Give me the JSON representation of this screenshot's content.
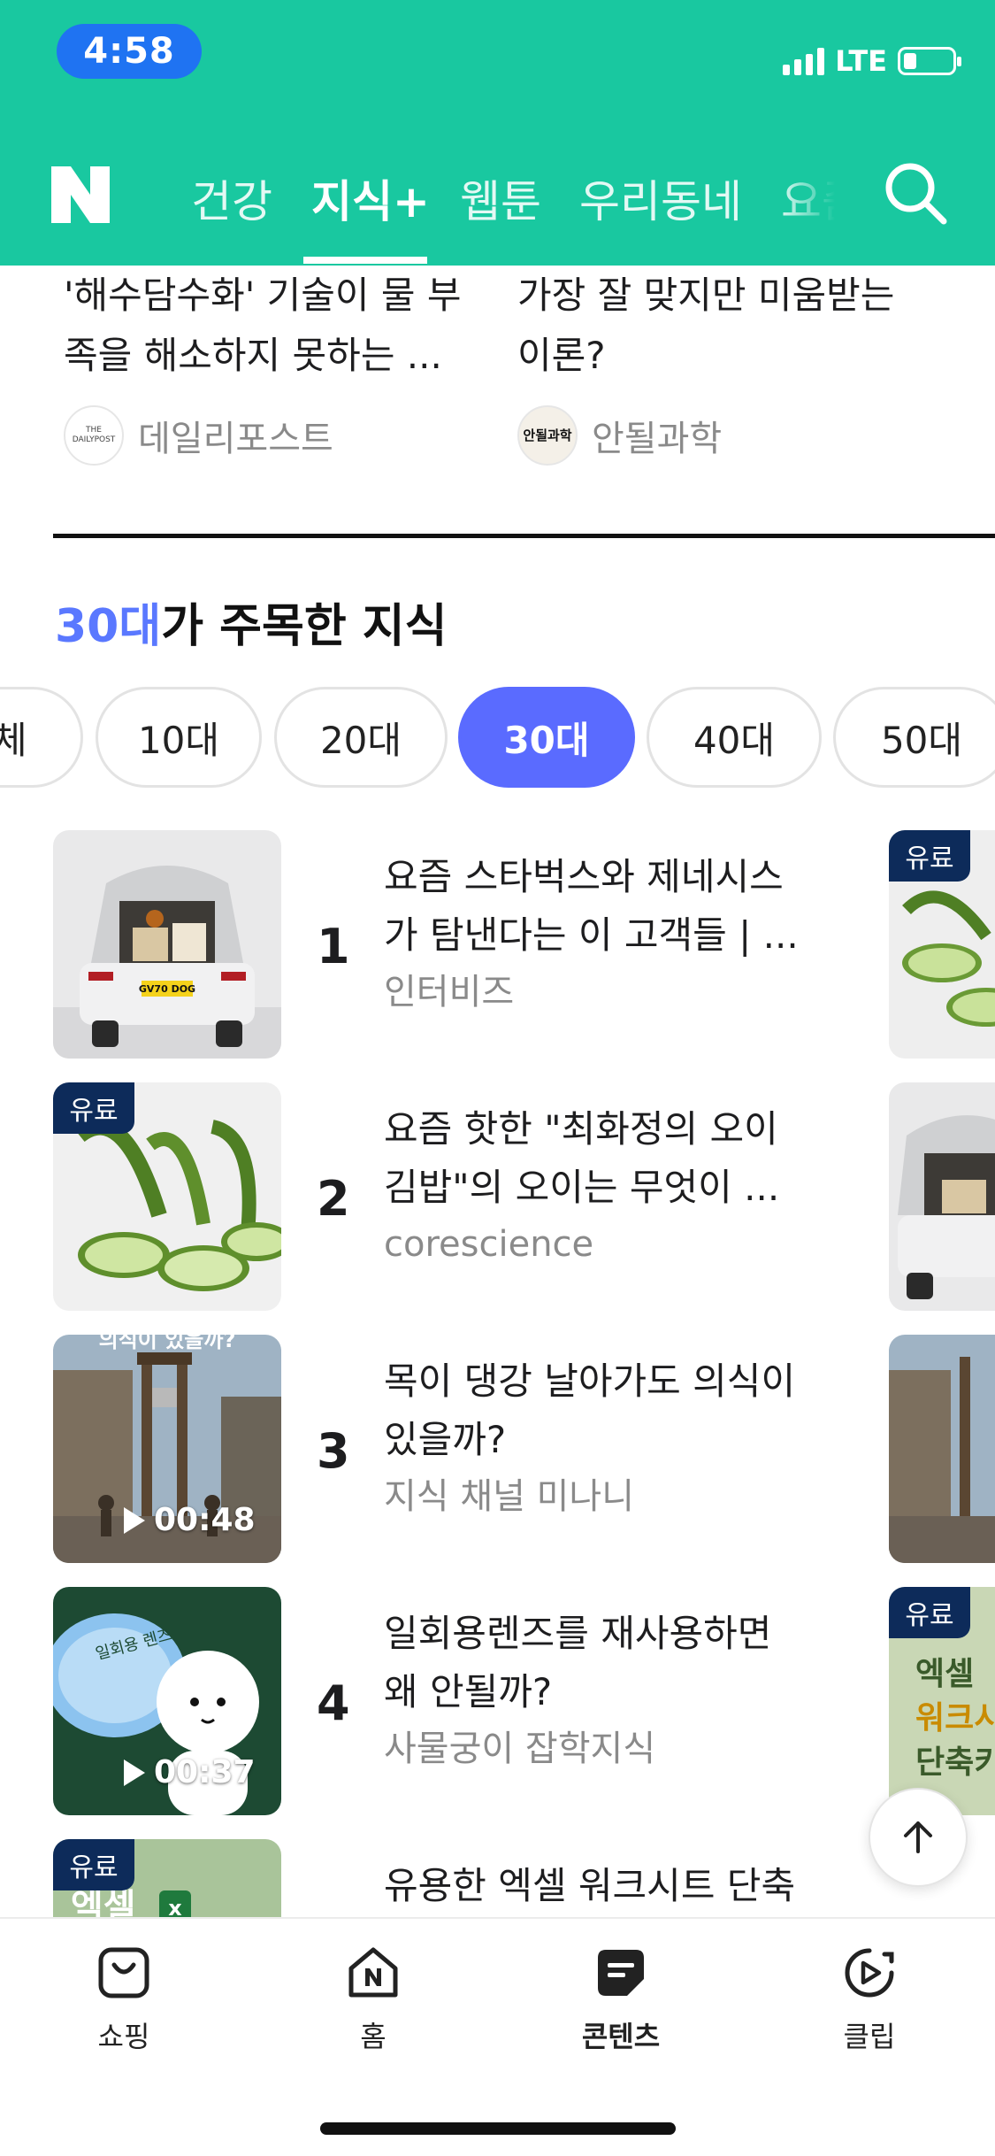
{
  "status_bar": {
    "time": "4:58",
    "network": "LTE"
  },
  "header": {
    "tabs": [
      {
        "label": "건강"
      },
      {
        "label": "지식+"
      },
      {
        "label": "웹툰"
      },
      {
        "label": "우리동네"
      },
      {
        "label": "요즘"
      }
    ],
    "active_tab": "지식+"
  },
  "top_articles": [
    {
      "title": "'해수담수화' 기술이 물 부족을 해소하지 못하는 ...",
      "source": "데일리포스트",
      "logo_text": "THE DAILYPOST"
    },
    {
      "title": "가장 잘 맞지만 미움받는 이론?",
      "source": "안될과학",
      "logo_text": "안될과학"
    }
  ],
  "section": {
    "accent": "30대",
    "rest": "가 주목한 지식"
  },
  "age_chips": [
    "전체",
    "10대",
    "20대",
    "30대",
    "40대",
    "50대"
  ],
  "active_chip": "30대",
  "ranking": [
    {
      "rank": "1",
      "title": "요즘 스타벅스와 제네시스가 탐낸다는 이 고객들 | ...",
      "source": "인터비즈",
      "plate": "GV70 DOG"
    },
    {
      "rank": "2",
      "title": "요즘 핫한 \"최화정의 오이김밥\"의 오이는 무엇이 ...",
      "source": "corescience",
      "badge": "유료"
    },
    {
      "rank": "3",
      "title": "목이 댕강 날아가도 의식이 있을까?",
      "source": "지식 채널 미나니",
      "duration": "00:48",
      "overlay": "의식이 있을까?"
    },
    {
      "rank": "4",
      "title": "일회용렌즈를 재사용하면 왜 안될까?",
      "source": "사물궁이 잡학지식",
      "duration": "00:37",
      "overlay": "일회용 렌즈"
    },
    {
      "rank": "5",
      "title": "유용한 엑셀 워크시트 단축",
      "source": "",
      "badge": "유료",
      "overlay": "엑셀"
    }
  ],
  "peek_column": {
    "badges": [
      "유료",
      "유료"
    ],
    "texts": [
      "엑셀",
      "워크시",
      "단축키"
    ]
  },
  "bottom_nav": [
    {
      "label": "쇼핑",
      "icon": "shopping-bag-icon"
    },
    {
      "label": "홈",
      "icon": "home-icon"
    },
    {
      "label": "콘텐츠",
      "icon": "contents-icon"
    },
    {
      "label": "클립",
      "icon": "clip-play-icon"
    }
  ],
  "active_bottom": "콘텐츠",
  "colors": {
    "brand_green": "#19c8a0",
    "accent_blue": "#5a6bff",
    "paid_badge": "#0d2b5a"
  }
}
